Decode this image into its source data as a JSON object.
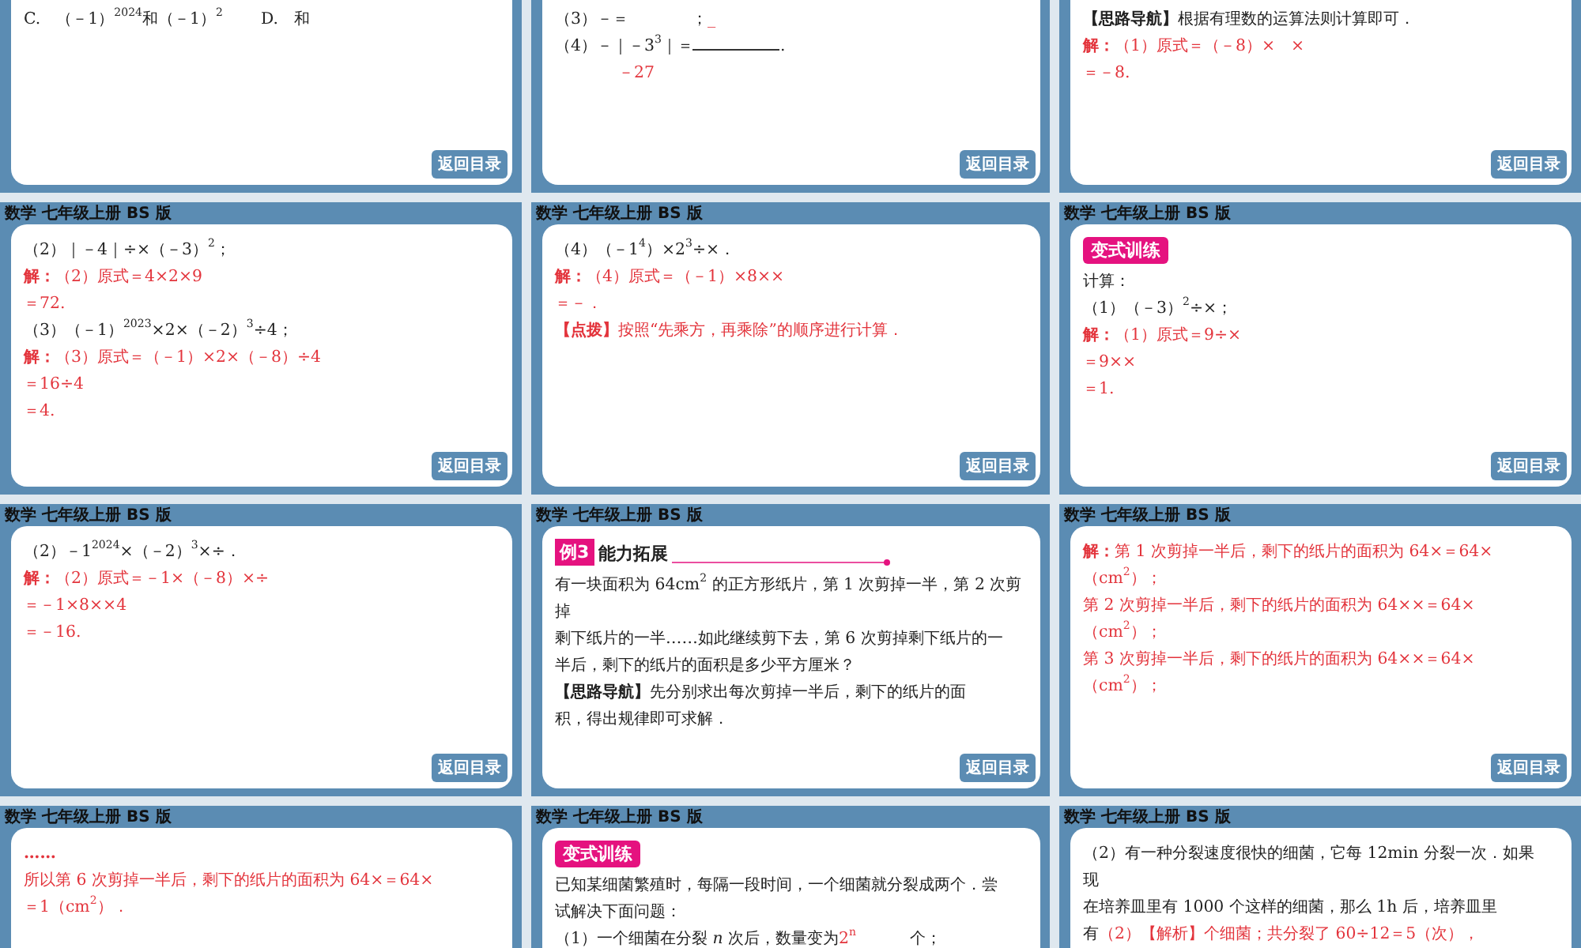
{
  "slides": [
    {
      "lines": [
        {
          "parts": [
            {
              "text": "C.　（－1）$^{2024}$和（－1）$^{2}$",
              "kind": "option"
            },
            {
              "text": "D.　和",
              "kind": "option"
            }
          ]
        }
      ],
      "back_button": "返回目录"
    },
    {
      "lines": [
        {
          "parts": [
            {
              "text": "（3）－＝",
              "kind": "q"
            },
            {
              "kind": "gap"
            },
            {
              "text": "；",
              "kind": "q"
            },
            {
              "text": "_",
              "kind": "a"
            }
          ]
        },
        {
          "parts": [
            {
              "text": "（4）－｜－3$^{3}$｜＝",
              "kind": "q"
            },
            {
              "kind": "line"
            },
            {
              "text": ".",
              "kind": "q"
            }
          ]
        },
        {
          "parts": [
            {
              "kind": "gap"
            },
            {
              "text": "－27",
              "kind": "a"
            }
          ]
        }
      ],
      "back_button": "返回目录"
    },
    {
      "lines": [
        {
          "parts": [
            {
              "text": "【思路导航】",
              "kind": "label"
            },
            {
              "text": "根据有理数的运算法则计算即可．",
              "kind": "q"
            }
          ]
        },
        {
          "parts": [
            {
              "text": "解：",
              "kind": "jie"
            },
            {
              "text": "（1）原式＝（－8）×　×",
              "kind": "a"
            }
          ]
        },
        {
          "parts": [
            {
              "text": "＝－8.",
              "kind": "a"
            }
          ]
        }
      ],
      "back_button": "返回目录"
    },
    {
      "header": "数学 七年级上册 BS 版",
      "lines": [
        {
          "parts": [
            {
              "text": "（2）｜－4｜÷×（－3）$^{2}$；",
              "kind": "q"
            }
          ]
        },
        {
          "parts": [
            {
              "text": "解：",
              "kind": "jie"
            },
            {
              "text": "（2）原式＝4×2×9",
              "kind": "a"
            }
          ]
        },
        {
          "parts": [
            {
              "text": "＝72.",
              "kind": "a"
            }
          ]
        },
        {
          "parts": [
            {
              "text": "（3）（－1）$^{2023}$×2×（－2）$^{3}$÷4；",
              "kind": "q"
            }
          ]
        },
        {
          "parts": [
            {
              "text": "解：",
              "kind": "jie"
            },
            {
              "text": "（3）原式＝（－1）×2×（－8）÷4",
              "kind": "a"
            }
          ]
        },
        {
          "parts": [
            {
              "text": "＝16÷4",
              "kind": "a"
            }
          ]
        },
        {
          "parts": [
            {
              "text": "＝4.",
              "kind": "a"
            }
          ]
        }
      ],
      "back_button": "返回目录"
    },
    {
      "header": "数学 七年级上册 BS 版",
      "lines": [
        {
          "parts": [
            {
              "text": "（4）（－1$^{4}$）×2$^{3}$÷×．",
              "kind": "q"
            }
          ]
        },
        {
          "parts": [
            {
              "text": "解：",
              "kind": "jie"
            },
            {
              "text": "（4）原式＝（－1）×8××",
              "kind": "a"
            }
          ]
        },
        {
          "parts": [
            {
              "text": "＝－．",
              "kind": "a"
            }
          ]
        },
        {
          "parts": [
            {
              "text": "【点拨】",
              "kind": "note"
            },
            {
              "text": "按照“先乘方，再乘除”的顺序进行计算．",
              "kind": "a"
            }
          ]
        }
      ],
      "back_button": "返回目录"
    },
    {
      "header": "数学 七年级上册 BS 版",
      "tag": {
        "kind": "pill",
        "text": "变式训练"
      },
      "lines": [
        {
          "parts": [
            {
              "text": "计算：",
              "kind": "q"
            }
          ]
        },
        {
          "parts": [
            {
              "text": "（1）（－3）$^{2}$÷×；",
              "kind": "q"
            }
          ]
        },
        {
          "parts": [
            {
              "text": "解：",
              "kind": "jie"
            },
            {
              "text": "（1）原式＝9÷×",
              "kind": "a"
            }
          ]
        },
        {
          "parts": [
            {
              "text": "＝9××",
              "kind": "a"
            }
          ]
        },
        {
          "parts": [
            {
              "text": "＝1.",
              "kind": "a"
            }
          ]
        }
      ],
      "back_button": "返回目录"
    },
    {
      "header": "数学 七年级上册 BS 版",
      "lines": [
        {
          "parts": [
            {
              "text": "（2）－1$^{2024}$×（－2）$^{3}$×÷．",
              "kind": "q"
            }
          ]
        },
        {
          "parts": [
            {
              "text": "解：",
              "kind": "jie"
            },
            {
              "text": "（2）原式＝－1×（－8）×÷",
              "kind": "a"
            }
          ]
        },
        {
          "parts": [
            {
              "text": "＝－1×8××4",
              "kind": "a"
            }
          ]
        },
        {
          "parts": [
            {
              "text": "＝－16.",
              "kind": "a"
            }
          ]
        }
      ],
      "back_button": "返回目录"
    },
    {
      "header": "数学 七年级上册 BS 版",
      "tag": {
        "kind": "example",
        "number": "例3",
        "text": "能力拓展"
      },
      "lines": [
        {
          "parts": [
            {
              "text": "有一块面积为 64cm$^{2}$ 的正方形纸片，第 1 次剪掉一半，第 2 次剪",
              "kind": "q"
            }
          ]
        },
        {
          "parts": [
            {
              "text": "掉",
              "kind": "q"
            }
          ]
        },
        {
          "parts": [
            {
              "text": "剩下纸片的一半……如此继续剪下去，第 6 次剪掉剩下纸片的一",
              "kind": "q"
            }
          ]
        },
        {
          "parts": [
            {
              "text": "半后，剩下的纸片的面积是多少平方厘米？",
              "kind": "q"
            }
          ]
        },
        {
          "parts": [
            {
              "text": "【思路导航】",
              "kind": "label"
            },
            {
              "text": "先分别求出每次剪掉一半后，剩下的纸片的面",
              "kind": "q"
            }
          ]
        },
        {
          "parts": [
            {
              "text": "积，得出规律即可求解．",
              "kind": "q"
            }
          ]
        }
      ],
      "back_button": "返回目录"
    },
    {
      "header": "数学 七年级上册 BS 版",
      "lines": [
        {
          "parts": [
            {
              "text": "解：",
              "kind": "jie"
            },
            {
              "text": "第 1 次剪掉一半后，剩下的纸片的面积为 64×＝64×",
              "kind": "a"
            }
          ]
        },
        {
          "parts": [
            {
              "text": "（cm$^{2}$）；",
              "kind": "a"
            }
          ]
        },
        {
          "parts": [
            {
              "text": "第 2 次剪掉一半后，剩下的纸片的面积为 64××＝64×",
              "kind": "a"
            }
          ]
        },
        {
          "parts": [
            {
              "text": "（cm$^{2}$）；",
              "kind": "a"
            }
          ]
        },
        {
          "parts": [
            {
              "text": "第 3 次剪掉一半后，剩下的纸片的面积为 64××＝64×",
              "kind": "a"
            }
          ]
        },
        {
          "parts": [
            {
              "text": "（cm$^{2}$）；",
              "kind": "a"
            }
          ]
        }
      ],
      "back_button": "返回目录"
    },
    {
      "header": "数学 七年级上册 BS 版",
      "lines": [
        {
          "parts": [
            {
              "text": "……",
              "kind": "note"
            }
          ]
        },
        {
          "parts": [
            {
              "text": "所以第 6 次剪掉一半后，剩下的纸片的面积为 64×＝64×",
              "kind": "a"
            }
          ]
        },
        {
          "parts": [
            {
              "text": "＝1（cm$^{2}$）．",
              "kind": "a"
            }
          ]
        }
      ]
    },
    {
      "header": "数学 七年级上册 BS 版",
      "tag": {
        "kind": "pill",
        "text": "变式训练"
      },
      "lines": [
        {
          "parts": [
            {
              "text": "已知某细菌繁殖时，每隔一段时间，一个细菌就分裂成两个．尝",
              "kind": "q"
            }
          ]
        },
        {
          "parts": [
            {
              "text": "试解决下面问题：",
              "kind": "q"
            }
          ]
        },
        {
          "parts": [
            {
              "text": "（1）一个细菌在分裂 *n* 次后，数量变为",
              "kind": "q"
            },
            {
              "text": "2$^{n}$",
              "kind": "blank"
            },
            {
              "text": "个；",
              "kind": "q"
            }
          ]
        }
      ]
    },
    {
      "header": "数学 七年级上册 BS 版",
      "lines": [
        {
          "parts": [
            {
              "text": "（2）有一种分裂速度很快的细菌，它每 12min 分裂一次．如果",
              "kind": "q"
            }
          ]
        },
        {
          "parts": [
            {
              "text": "现",
              "kind": "q"
            }
          ]
        },
        {
          "parts": [
            {
              "text": "在培养皿里有 1000 个这样的细菌，那么 1h 后，培养皿里",
              "kind": "q"
            }
          ]
        },
        {
          "parts": [
            {
              "text": "有",
              "kind": "q"
            },
            {
              "text": "（2）【解析】个细菌；共分裂了 60÷12＝5（次），",
              "kind": "a"
            }
          ]
        }
      ]
    }
  ]
}
